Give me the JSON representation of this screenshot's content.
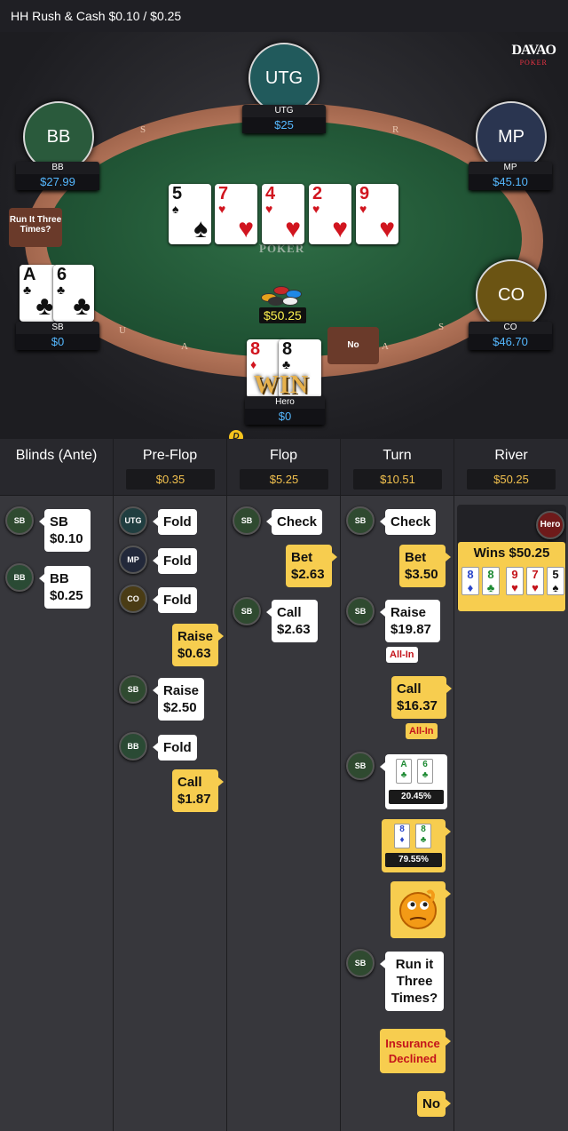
{
  "header": {
    "title": "HH  Rush & Cash $0.10 / $0.25"
  },
  "brand": {
    "line1": "DAVAO",
    "line2": "POKER"
  },
  "felt_logo": "POKER",
  "seats": {
    "utg": {
      "label": "UTG",
      "name": "UTG",
      "stack": "$25"
    },
    "bb": {
      "label": "BB",
      "name": "BB",
      "stack": "$27.99"
    },
    "mp": {
      "label": "MP",
      "name": "MP",
      "stack": "$45.10"
    },
    "co": {
      "label": "CO",
      "name": "CO",
      "stack": "$46.70"
    },
    "sb": {
      "name": "SB",
      "stack": "$0"
    },
    "hero": {
      "name": "Hero",
      "stack": "$0"
    }
  },
  "board": [
    {
      "rank": "5",
      "suit": "♠",
      "color": "black"
    },
    {
      "rank": "7",
      "suit": "♥",
      "color": "red"
    },
    {
      "rank": "4",
      "suit": "♥",
      "color": "red"
    },
    {
      "rank": "2",
      "suit": "♥",
      "color": "red"
    },
    {
      "rank": "9",
      "suit": "♥",
      "color": "red"
    }
  ],
  "sb_cards": [
    {
      "rank": "A",
      "suit": "♣"
    },
    {
      "rank": "6",
      "suit": "♣"
    }
  ],
  "hero_cards": [
    {
      "rank": "8",
      "suit": "♦"
    },
    {
      "rank": "8",
      "suit": "♣"
    }
  ],
  "pot": "$50.25",
  "win_text": "WIN",
  "run_it_three_btn": "Run It Three Times?",
  "no_btn": "No",
  "dealer_button": "D",
  "history": {
    "columns": [
      {
        "title": "Blinds (Ante)",
        "pot": ""
      },
      {
        "title": "Pre-Flop",
        "pot": "$0.35"
      },
      {
        "title": "Flop",
        "pot": "$5.25"
      },
      {
        "title": "Turn",
        "pot": "$10.51"
      },
      {
        "title": "River",
        "pot": "$50.25"
      }
    ],
    "blinds": {
      "sb": {
        "pos": "SB",
        "line1": "SB",
        "line2": "$0.10"
      },
      "bb": {
        "pos": "BB",
        "line1": "BB",
        "line2": "$0.25"
      }
    },
    "preflop": {
      "utg": {
        "pos": "UTG",
        "action": "Fold"
      },
      "mp": {
        "pos": "MP",
        "action": "Fold"
      },
      "co": {
        "pos": "CO",
        "action": "Fold"
      },
      "hero_raise": {
        "line1": "Raise",
        "line2": "$0.63"
      },
      "sb_raise": {
        "pos": "SB",
        "line1": "Raise",
        "line2": "$2.50"
      },
      "bb": {
        "pos": "BB",
        "action": "Fold"
      },
      "hero_call": {
        "line1": "Call",
        "line2": "$1.87"
      }
    },
    "flop": {
      "sb_check": {
        "pos": "SB",
        "action": "Check"
      },
      "hero_bet": {
        "line1": "Bet",
        "line2": "$2.63"
      },
      "sb_call": {
        "pos": "SB",
        "line1": "Call",
        "line2": "$2.63"
      }
    },
    "turn": {
      "sb_check": {
        "pos": "SB",
        "action": "Check"
      },
      "hero_bet": {
        "line1": "Bet",
        "line2": "$3.50"
      },
      "sb_raise": {
        "pos": "SB",
        "line1": "Raise",
        "line2": "$19.87",
        "tag": "All-In"
      },
      "hero_call": {
        "line1": "Call",
        "line2": "$16.37",
        "tag": "All-In"
      },
      "sb_show": {
        "pos": "SB",
        "cards": [
          {
            "rank": "A",
            "suit": "♣"
          },
          {
            "rank": "6",
            "suit": "♣"
          }
        ],
        "equity": "20.45%"
      },
      "hero_show": {
        "cards": [
          {
            "rank": "8",
            "suit": "♦"
          },
          {
            "rank": "8",
            "suit": "♣"
          }
        ],
        "equity": "79.55%"
      },
      "sb_prompt": {
        "pos": "SB",
        "line1": "Run it",
        "line2": "Three",
        "line3": "Times?"
      },
      "hero_ins": {
        "line1": "Insurance",
        "line2": "Declined"
      },
      "hero_no": {
        "text": "No"
      }
    },
    "river": {
      "winner": "Hero",
      "wins": "Wins $50.25",
      "cards": [
        {
          "rank": "8",
          "suit": "♦",
          "color": "#2a46c9"
        },
        {
          "rank": "8",
          "suit": "♣",
          "color": "#1d8a32"
        },
        {
          "rank": "9",
          "suit": "♥",
          "color": "#c4141b"
        },
        {
          "rank": "7",
          "suit": "♥",
          "color": "#c4141b"
        },
        {
          "rank": "5",
          "suit": "♠",
          "color": "#111"
        }
      ]
    }
  }
}
